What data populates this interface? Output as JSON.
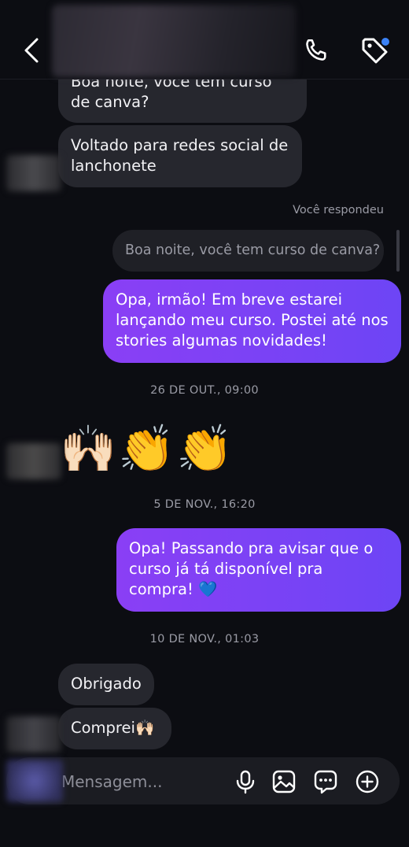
{
  "composer": {
    "placeholder": "Mensagem..."
  },
  "messages": {
    "in1": "Boa noite, você tem curso de canva?",
    "in2": "Voltado para redes social de lanchonete",
    "reply_label": "Você respondeu",
    "quoted": "Boa noite, você tem curso de canva?",
    "out1": "Opa, irmão! Em breve estarei lançando meu curso. Postei até nos stories algumas novidades!",
    "ts1": "26 DE OUT., 09:00",
    "reaction": "🙌🏻👏👏",
    "ts2": "5 DE NOV., 16:20",
    "out2_text": "Opa! Passando pra avisar que o curso já tá disponível pra compra!",
    "out2_emoji": "💙",
    "ts3": "10 DE NOV., 01:03",
    "in3": "Obrigado",
    "in4_text": "Comprei",
    "in4_emoji": "🙌🏻"
  },
  "icons": {
    "back": "chevron-left-icon",
    "phone": "phone-icon",
    "tag": "tag-icon",
    "mic": "microphone-icon",
    "gallery": "image-icon",
    "sticker": "chat-bubble-icon",
    "add": "plus-circle-icon"
  },
  "colors": {
    "background": "#0c0d12",
    "incoming_bubble": "#26272e",
    "outgoing_start": "#8a3ff5",
    "outgoing_end": "#6d45f5",
    "notification_dot": "#3b82f6"
  }
}
